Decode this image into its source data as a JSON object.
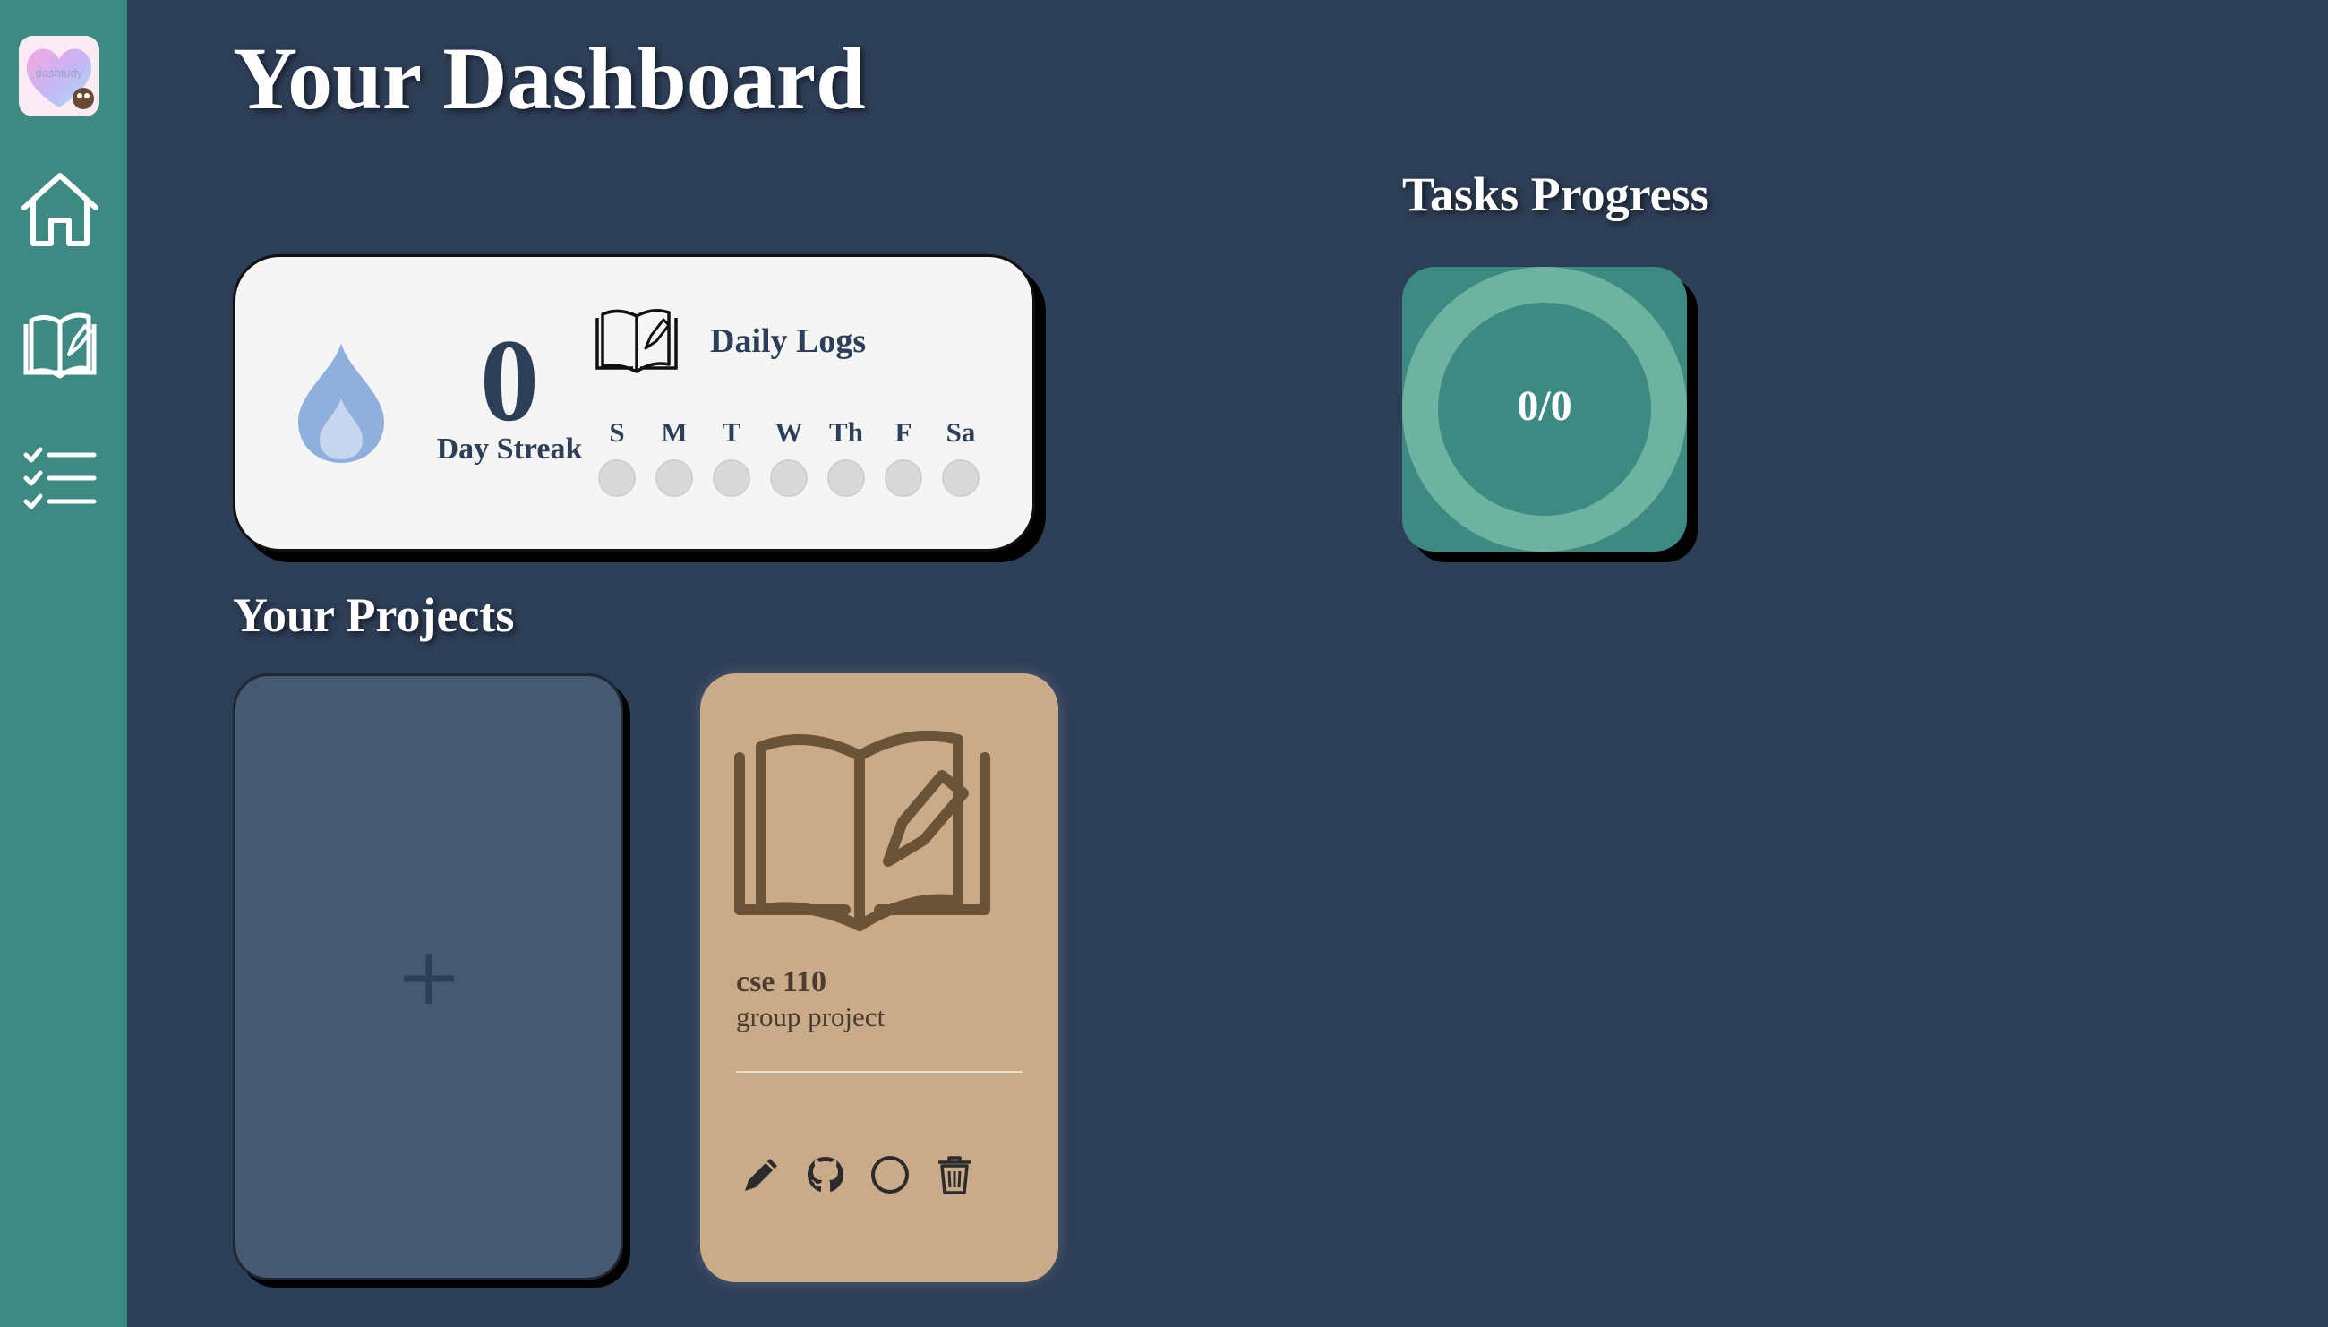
{
  "sidebar": {
    "logo_text": "dashtudy",
    "items": [
      {
        "name": "home",
        "icon": "home-icon"
      },
      {
        "name": "daily-logs",
        "icon": "book-pen-icon"
      },
      {
        "name": "tasks",
        "icon": "checklist-icon"
      }
    ]
  },
  "page": {
    "title": "Your Dashboard"
  },
  "streak": {
    "count": "0",
    "label": "Day Streak",
    "icon": "flame-icon"
  },
  "daily_logs": {
    "title": "Daily Logs",
    "icon": "book-pen-icon",
    "days": [
      "S",
      "M",
      "T",
      "W",
      "Th",
      "F",
      "Sa"
    ]
  },
  "tasks": {
    "title": "Tasks Progress",
    "value": "0/0"
  },
  "projects": {
    "title": "Your Projects",
    "add_icon": "plus-icon",
    "items": [
      {
        "name": "cse 110",
        "description": "group project",
        "icon": "book-pen-icon",
        "actions": [
          "pencil-icon",
          "github-icon",
          "circle-icon",
          "trash-icon"
        ]
      }
    ]
  },
  "colors": {
    "background": "#2d3e57",
    "sidebar": "#3d8a82",
    "project_card": "#c9ab89",
    "flame": "#8fb0dc",
    "ring": "#6db3a0"
  }
}
